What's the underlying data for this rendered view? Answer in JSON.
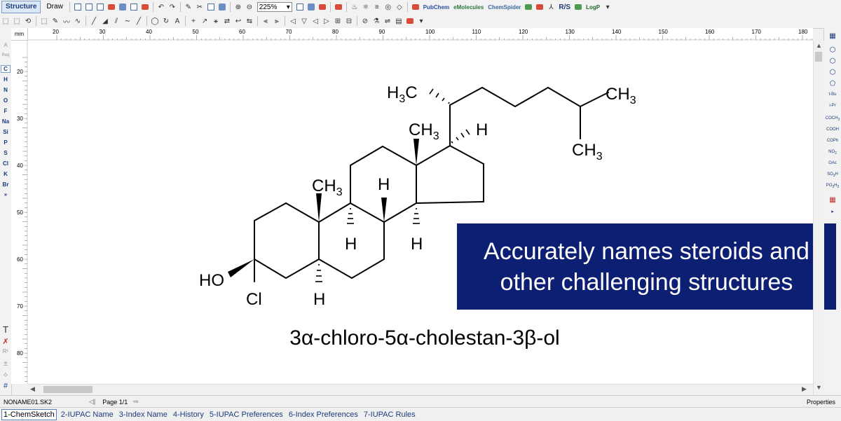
{
  "toolbar": {
    "structure_tab": "Structure",
    "draw_tab": "Draw",
    "zoom": "225%",
    "brands": [
      "PubChem",
      "eMolecules",
      "ChemSpider"
    ],
    "rs_label": "R/S",
    "logp_label": "LogP"
  },
  "ruler": {
    "unit": "mm",
    "top_ticks": [
      "20",
      "30",
      "40",
      "50",
      "60",
      "70",
      "80",
      "90",
      "100",
      "110",
      "120",
      "130",
      "140",
      "150",
      "160",
      "170",
      "180"
    ],
    "left_ticks": [
      "20",
      "30",
      "40",
      "50",
      "60",
      "70",
      "80"
    ]
  },
  "left_palette": {
    "elements": [
      "C",
      "H",
      "N",
      "O",
      "F",
      "Na",
      "Si",
      "P",
      "S",
      "Cl",
      "K",
      "Br"
    ],
    "selected": "C",
    "top_labels": [
      "A",
      "Req"
    ],
    "more": "»",
    "tools": [
      "T",
      "R¹"
    ]
  },
  "right_palette": {
    "groups": [
      "t-Bu",
      "i-Pr",
      "COCH3",
      "COOH",
      "COPh",
      "NO2",
      "OAc",
      "SO3H",
      "PO3H2"
    ]
  },
  "molecule": {
    "labels": {
      "h3c_top": "H3C",
      "ch3_right": "CH3",
      "ch3_lower": "CH3",
      "ch3_c13": "CH3",
      "h_c17": "H",
      "ch3_c10": "CH3",
      "h_c8": "H",
      "h_c9": "H",
      "h_c14": "H",
      "ho": "HO",
      "cl": "Cl",
      "h_c5": "H"
    },
    "name": "3α-chloro-5α-cholestan-3β-ol"
  },
  "callout": {
    "text": "Accurately names steroids and\nother challenging structures"
  },
  "status": {
    "file": "NONAME01.SK2",
    "page": "Page 1/1",
    "properties": "Properties"
  },
  "bottom_tabs": [
    "1-ChemSketch",
    "2-IUPAC Name",
    "3-Index Name",
    "4-History",
    "5-IUPAC Preferences",
    "6-Index Preferences",
    "7-IUPAC Rules"
  ]
}
